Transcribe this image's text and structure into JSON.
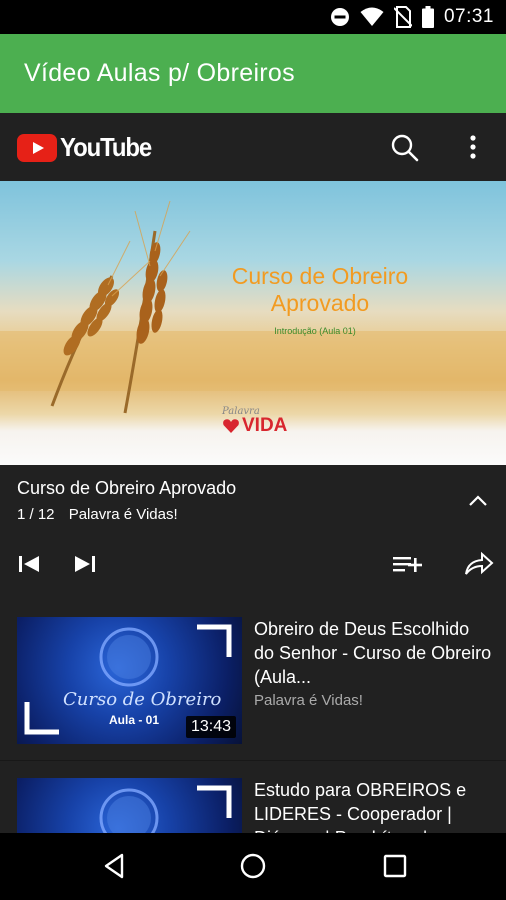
{
  "status_bar": {
    "time": "07:31",
    "icons": [
      "do-not-disturb-icon",
      "wifi-icon",
      "no-sim-icon",
      "battery-icon"
    ]
  },
  "app_bar": {
    "title": "Vídeo Aulas p/ Obreiros",
    "color": "#4caf50"
  },
  "youtube_header": {
    "logo_text": "YouTube",
    "icons": [
      "search-icon",
      "more-vert-icon"
    ]
  },
  "player": {
    "thumbnail_title": "Curso de Obreiro Aprovado",
    "thumbnail_subtitle": "Introdução (Aula 01)",
    "brand_script": "Palavra",
    "brand_name": "VIDA"
  },
  "playlist": {
    "title": "Curso de Obreiro Aprovado",
    "position": "1 / 12",
    "channel": "Palavra é Vidas!",
    "controls": [
      "skip-previous-icon",
      "skip-next-icon",
      "add-to-playlist-icon",
      "share-icon"
    ]
  },
  "videos": [
    {
      "title": "Obreiro de Deus Escolhido do Senhor - Curso de Obreiro (Aula...",
      "channel": "Palavra é Vidas!",
      "duration": "13:43",
      "thumb_script": "Curso de Obreiro",
      "thumb_label": "Aula - 01"
    },
    {
      "title": "Estudo para OBREIROS e LIDERES - Cooperador | Diácono | Presbítero |...",
      "channel": "",
      "duration": "",
      "thumb_script": "",
      "thumb_label": ""
    }
  ],
  "nav_bar": {
    "icons": [
      "back-icon",
      "home-icon",
      "recent-apps-icon"
    ]
  }
}
